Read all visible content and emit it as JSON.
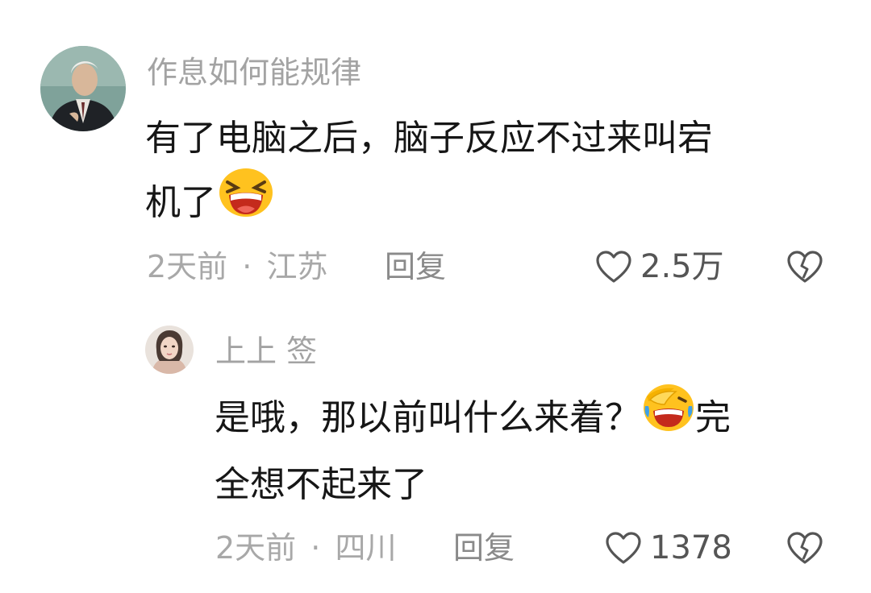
{
  "comments": [
    {
      "username": "作息如何能规律",
      "content_lines": [
        "有了电脑之后，脑子反应不过来叫宕",
        "机了"
      ],
      "emoji": "laughing-emoji",
      "time": "2天前",
      "separator": "·",
      "location": "江苏",
      "reply_label": "回复",
      "like_count": "2.5万"
    }
  ],
  "replies": [
    {
      "username": "上上 签",
      "content_lines": [
        "是哦，那以前叫什么来着？",
        "全想不起来了"
      ],
      "content_after_emoji": "完",
      "emoji": "face-palm-laughing-emoji",
      "time": "2天前",
      "separator": "·",
      "location": "四川",
      "reply_label": "回复",
      "like_count": "1378"
    }
  ],
  "colors": {
    "text": "#161616",
    "muted": "#a8a8a8",
    "icon": "#555555"
  }
}
